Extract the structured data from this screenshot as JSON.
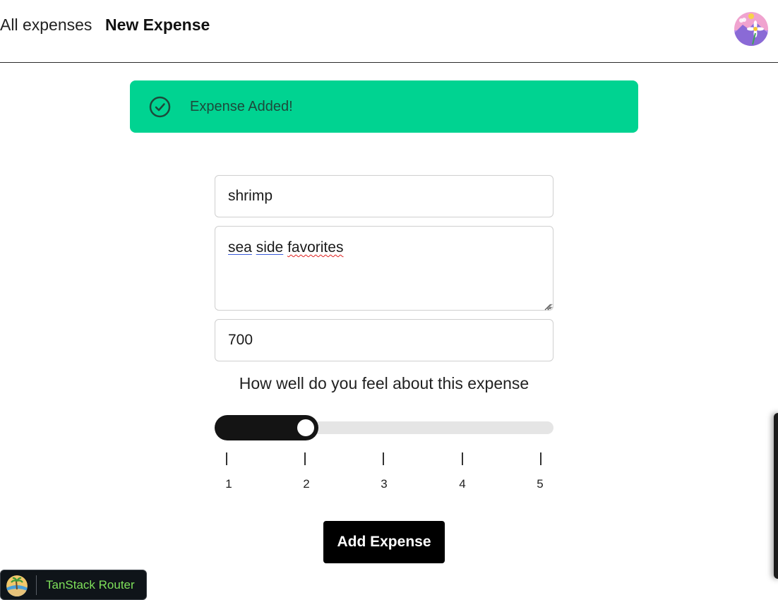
{
  "nav": {
    "all_expenses": "All expenses",
    "new_expense": "New Expense"
  },
  "toast": {
    "message": "Expense Added!",
    "icon": "check-circle-icon",
    "color": "#00d391"
  },
  "form": {
    "title_value": "shrimp",
    "description_words": [
      "sea",
      "side",
      "favorites"
    ],
    "amount_value": "700",
    "question": "How well do you feel about this expense",
    "slider": {
      "value": 2,
      "min": 1,
      "max": 5,
      "tick_labels": [
        "|",
        "|",
        "|",
        "|",
        "|"
      ],
      "labels": [
        "1",
        "2",
        "3",
        "4",
        "5"
      ]
    },
    "submit_label": "Add Expense"
  },
  "devtools": {
    "label": "TanStack Router",
    "text_color": "#7ee05a"
  }
}
